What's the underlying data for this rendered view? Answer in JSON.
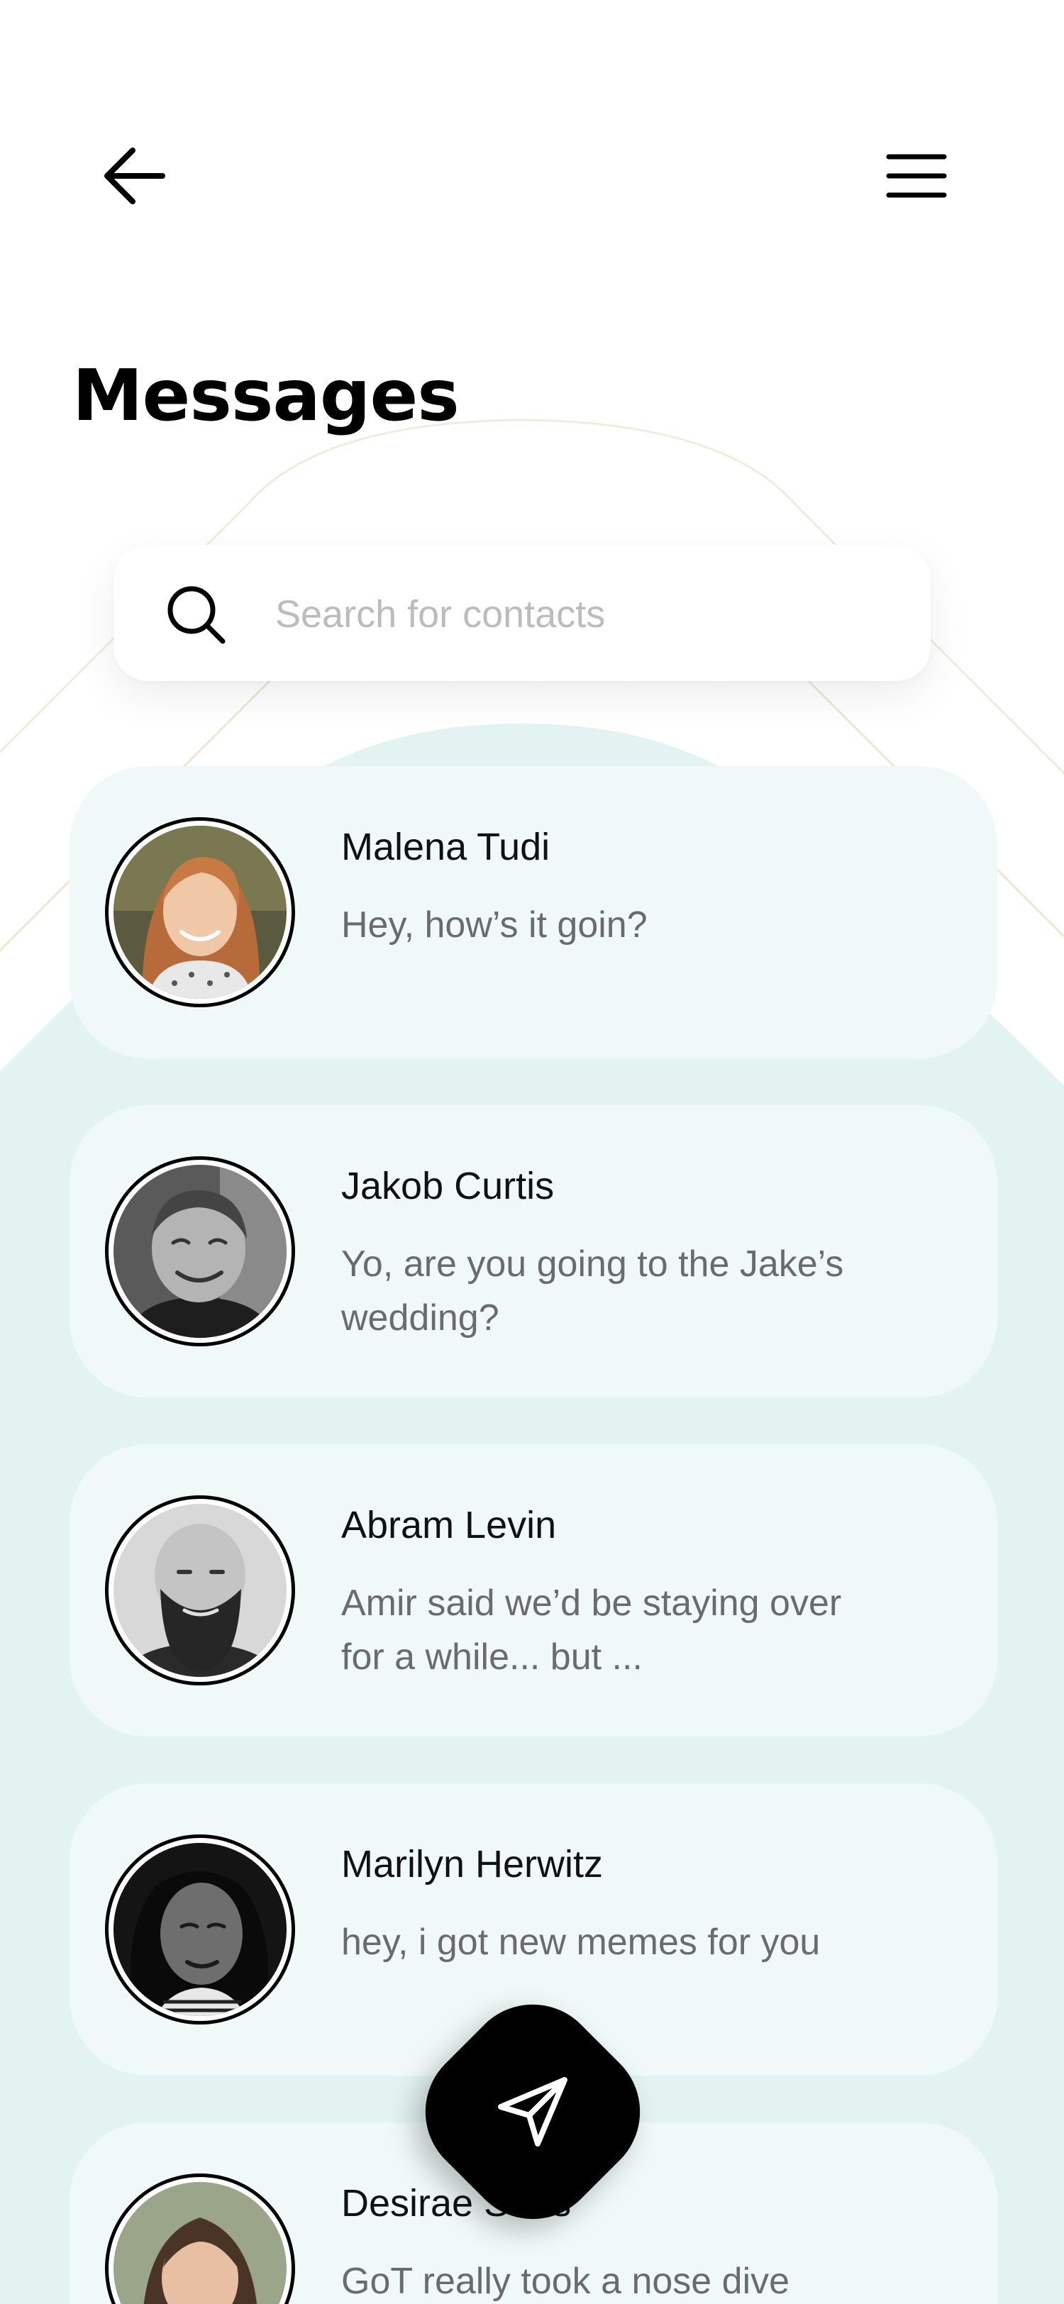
{
  "header": {
    "back_icon": "arrow-left-icon",
    "menu_icon": "hamburger-menu-icon",
    "title": "Messages"
  },
  "search": {
    "icon": "search-icon",
    "placeholder": "Search for contacts",
    "value": ""
  },
  "conversations": [
    {
      "name": "Malena Tudi",
      "message": "Hey, how’s it goin?",
      "avatar": "portrait-smiling-woman-red-hair"
    },
    {
      "name": "Jakob Curtis",
      "message": "Yo, are you going to the Jake’s wedding?",
      "avatar": "portrait-smiling-man-black-and-white"
    },
    {
      "name": "Abram Levin",
      "message": "Amir said we’d be staying over for a while... but ...",
      "avatar": "portrait-bald-bearded-man-black-and-white"
    },
    {
      "name": "Marilyn Herwitz",
      "message": "hey, i got new memes for you",
      "avatar": "portrait-woman-braids-black-and-white"
    },
    {
      "name": "Desirae Saris",
      "message": "GoT really took a nose dive",
      "avatar": "portrait-woman-brown-hair"
    }
  ],
  "fab": {
    "icon": "send-paper-plane-icon"
  },
  "colors": {
    "accent_teal_bg": "#e2f3f2",
    "card_bg": "#f0f9f8",
    "text_primary": "#111111",
    "text_secondary": "#6b6b6b",
    "placeholder": "#bcbcbc",
    "fab_bg": "#000000"
  }
}
